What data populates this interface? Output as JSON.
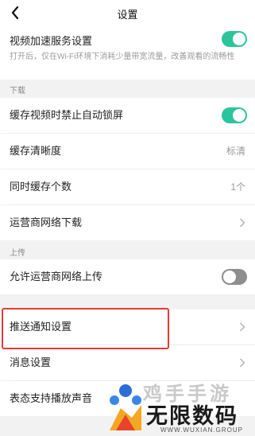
{
  "nav": {
    "title": "设置",
    "back_icon": "chevron-left-icon"
  },
  "video_accel": {
    "label": "视频加速服务设置",
    "enabled": true,
    "description": "打开后，仅在Wi-Fi环境下消耗少量带宽流量，改善观看的流畅性"
  },
  "download": {
    "section_title": "下载",
    "items": [
      {
        "label": "缓存视频时禁止自动锁屏",
        "type": "toggle",
        "enabled": true
      },
      {
        "label": "缓存清晰度",
        "type": "value",
        "value": "标清"
      },
      {
        "label": "同时缓存个数",
        "type": "value",
        "value": "1个"
      },
      {
        "label": "运营商网络下载",
        "type": "link"
      }
    ]
  },
  "upload": {
    "section_title": "上传",
    "items": [
      {
        "label": "允许运营商网络上传",
        "type": "toggle",
        "enabled": false
      }
    ]
  },
  "notify": {
    "items": [
      {
        "label": "推送通知设置",
        "type": "link"
      },
      {
        "label": "消息设置",
        "type": "link"
      },
      {
        "label": "表态支持播放声音",
        "type": "link"
      }
    ]
  },
  "colors": {
    "accent": "#2bc49d",
    "highlight": "#e53b36",
    "toggle_off": "#8e8e8e"
  },
  "watermark": {
    "brand_top": "鸡手手游",
    "brand_main": "无限数码",
    "url": "WWW.WUXIAN.GROUP"
  }
}
